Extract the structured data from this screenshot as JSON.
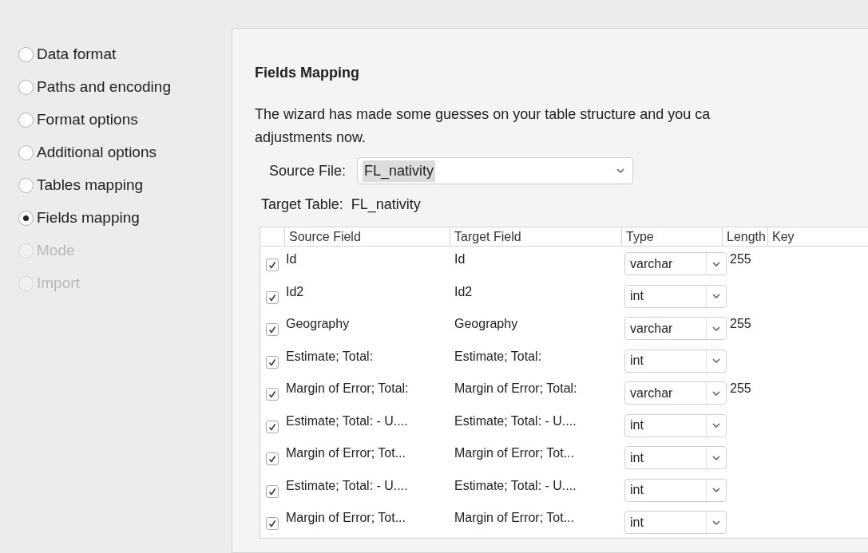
{
  "steps": [
    {
      "label": "Data format",
      "selected": false,
      "disabled": false
    },
    {
      "label": "Paths and encoding",
      "selected": false,
      "disabled": false
    },
    {
      "label": "Format options",
      "selected": false,
      "disabled": false
    },
    {
      "label": "Additional options",
      "selected": false,
      "disabled": false
    },
    {
      "label": "Tables mapping",
      "selected": false,
      "disabled": false
    },
    {
      "label": "Fields mapping",
      "selected": true,
      "disabled": false
    },
    {
      "label": "Mode",
      "selected": false,
      "disabled": true
    },
    {
      "label": "Import",
      "selected": false,
      "disabled": true
    }
  ],
  "panel": {
    "title": "Fields Mapping",
    "description_lines": [
      "The wizard has made some guesses on your table structure and you ca",
      "adjustments now."
    ],
    "source_file": {
      "label": "Source File:",
      "value": "FL_nativity"
    },
    "target_table": {
      "label": "Target Table:",
      "value": "FL_nativity"
    },
    "table": {
      "columns": [
        "Source Field",
        "Target Field",
        "Type",
        "Length",
        "Key"
      ],
      "rows": [
        {
          "checked": true,
          "source": "Id",
          "target": "Id",
          "type": "varchar",
          "length": "255"
        },
        {
          "checked": true,
          "source": "Id2",
          "target": "Id2",
          "type": "int"
        },
        {
          "checked": true,
          "source": "Geography",
          "target": "Geography",
          "type": "varchar",
          "length": "255"
        },
        {
          "checked": true,
          "source": "Estimate; Total:",
          "target": "Estimate; Total:",
          "type": "int"
        },
        {
          "checked": true,
          "source": "Margin of Error; Total:",
          "target": "Margin of Error; Total:",
          "type": "varchar",
          "length": "255"
        },
        {
          "checked": true,
          "source": "Estimate; Total: - U....",
          "target": "Estimate; Total: - U....",
          "type": "int"
        },
        {
          "checked": true,
          "source": "Margin of Error; Tot...",
          "target": "Margin of Error; Tot...",
          "type": "int"
        },
        {
          "checked": true,
          "source": "Estimate; Total: - U....",
          "target": "Estimate; Total: - U....",
          "type": "int"
        },
        {
          "checked": true,
          "source": "Margin of Error; Tot...",
          "target": "Margin of Error; Tot...",
          "type": "int"
        }
      ]
    }
  }
}
